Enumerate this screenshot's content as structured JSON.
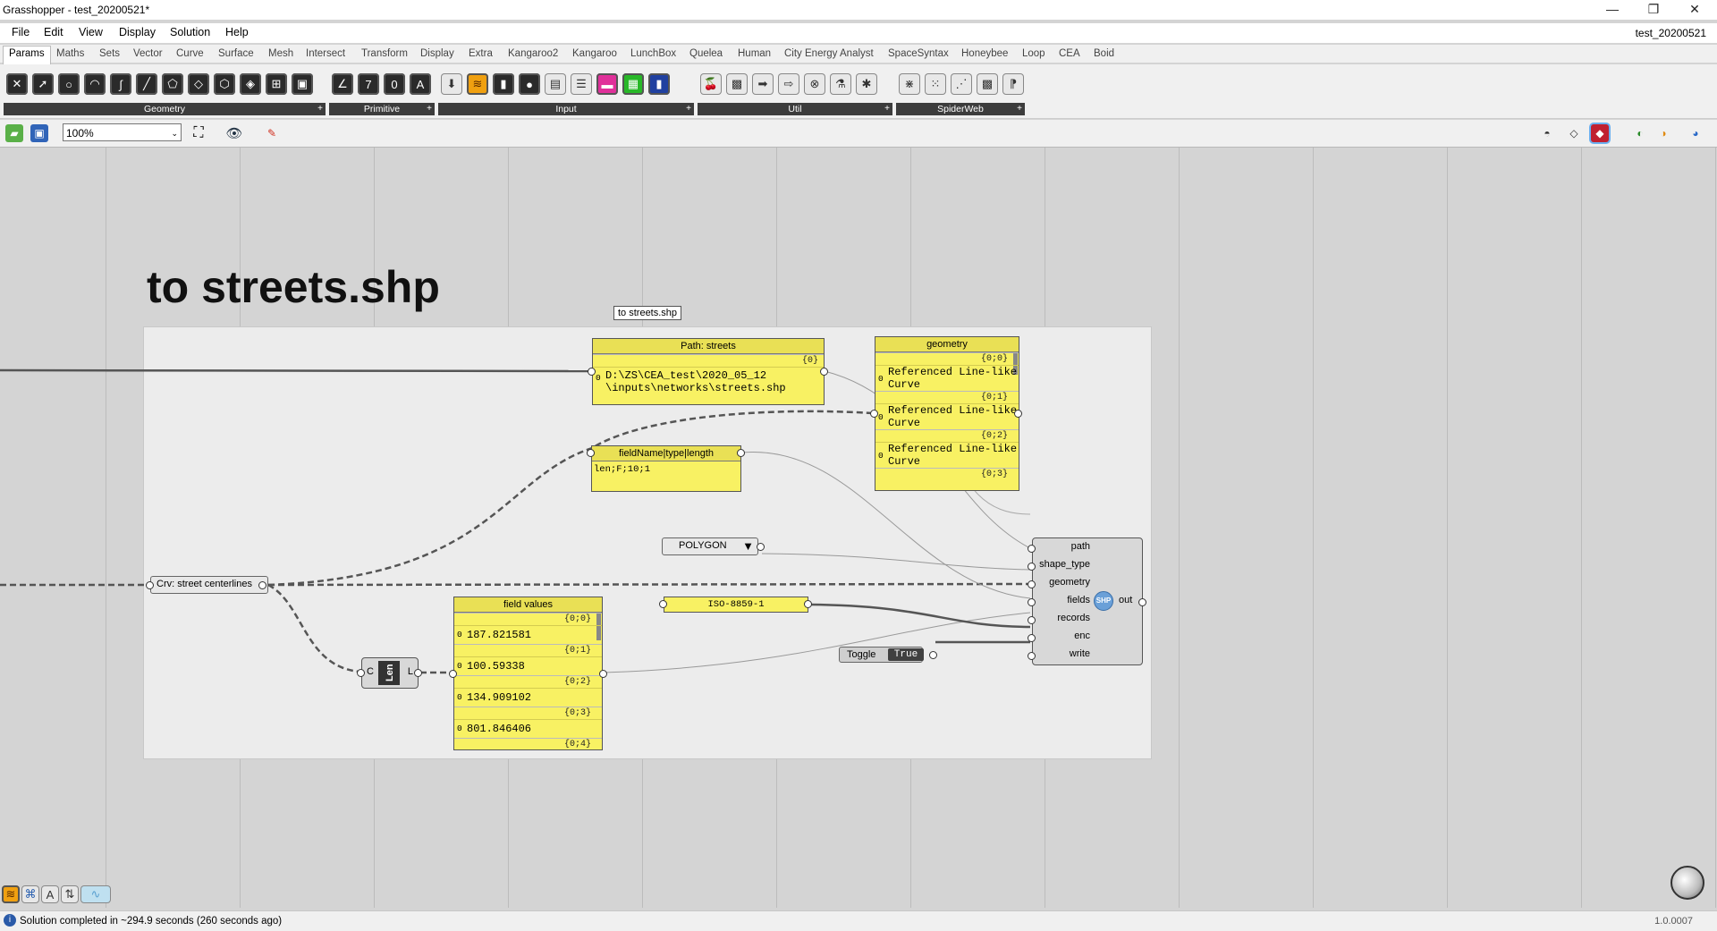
{
  "window": {
    "title": "Grasshopper - test_20200521*",
    "minimize": "—",
    "restore": "❐",
    "close": "✕"
  },
  "menu": [
    "File",
    "Edit",
    "View",
    "Display",
    "Solution",
    "Help"
  ],
  "doc_name": "test_20200521",
  "tabs": [
    "Params",
    "Maths",
    "Sets",
    "Vector",
    "Curve",
    "Surface",
    "Mesh",
    "Intersect",
    "Transform",
    "Display",
    "Extra",
    "Kangaroo2",
    "Kangaroo",
    "LunchBox",
    "Quelea",
    "Human",
    "City Energy Analyst",
    "SpaceSyntax",
    "Honeybee",
    "Loop",
    "CEA",
    "Boid"
  ],
  "ribbon_panels": [
    {
      "label": "Geometry",
      "plus": "+"
    },
    {
      "label": "Primitive",
      "plus": "+"
    },
    {
      "label": "Input",
      "plus": "+"
    },
    {
      "label": "Util",
      "plus": "+"
    },
    {
      "label": "SpiderWeb",
      "plus": "+"
    }
  ],
  "toolbar": {
    "zoom": "100%",
    "zoom_arrow": "⌄"
  },
  "canvas": {
    "big_title": "to streets.shp",
    "group_label": "to streets.shp",
    "path_panel": {
      "header": "Path: streets",
      "branch": "{0}",
      "index": "0",
      "line1": "D:\\ZS\\CEA_test\\2020_05_12",
      "line2": "\\inputs\\networks\\streets.shp"
    },
    "geometry_panel": {
      "header": "geometry",
      "branches": [
        "{0;0}",
        "{0;1}",
        "{0;2}",
        "{0;3}"
      ],
      "items": [
        "Referenced Line-like Curve",
        "Referenced Line-like Curve",
        "Referenced Line-like Curve"
      ],
      "index": "0"
    },
    "fieldname_panel": {
      "header": "fieldName|type|length",
      "value": "len;F;10;1"
    },
    "polygon_list": {
      "value": "POLYGON",
      "arrow": "▼"
    },
    "crv_param": "Crv: street centerlines",
    "field_values_panel": {
      "header": "field values",
      "branches": [
        "{0;0}",
        "{0;1}",
        "{0;2}",
        "{0;3}",
        "{0;4}"
      ],
      "values": [
        "187.821581",
        "100.59338",
        "134.909102",
        "801.846406"
      ],
      "index": "0"
    },
    "encoding_panel": "ISO-8859-1",
    "toggle": {
      "label": "Toggle",
      "value": "True"
    },
    "len_component": {
      "input": "C",
      "name": "Len",
      "output": "L"
    },
    "shp_component": {
      "inputs": [
        "path",
        "shape_type",
        "geometry",
        "fields",
        "records",
        "enc",
        "write"
      ],
      "output": "out",
      "icon": "SHP"
    }
  },
  "status": {
    "message": "Solution completed in ~294.9 seconds (260 seconds ago)",
    "version": "1.0.0007",
    "info_icon": "i"
  }
}
